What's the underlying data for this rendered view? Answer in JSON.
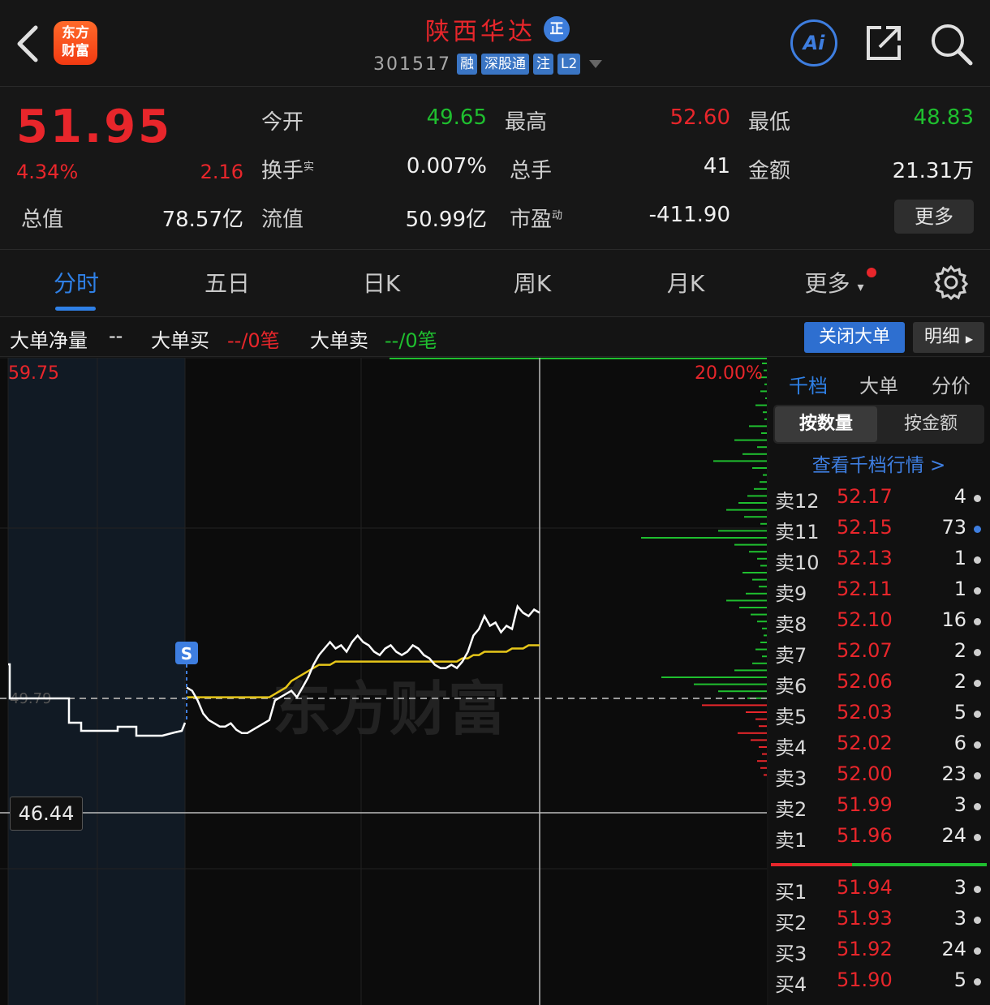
{
  "header": {
    "logo_line1": "东方",
    "logo_line2": "财富",
    "stock_name": "陕西华达",
    "zheng_badge": "正",
    "stock_code": "301517",
    "tags": [
      "融",
      "深股通",
      "注",
      "L2"
    ],
    "ai_label": "Ai"
  },
  "quote": {
    "price": "51.95",
    "change_pct": "4.34%",
    "change": "2.16",
    "open_label": "今开",
    "open": "49.65",
    "high_label": "最高",
    "high": "52.60",
    "low_label": "最低",
    "low": "48.83",
    "turnover_label": "换手",
    "turnover_sup": "实",
    "turnover": "0.007%",
    "volume_label": "总手",
    "volume": "41",
    "amount_label": "金额",
    "amount": "21.31万",
    "mktcap_label": "总值",
    "mktcap": "78.57亿",
    "float_label": "流值",
    "float": "50.99亿",
    "pe_label": "市盈",
    "pe_sup": "动",
    "pe": "-411.90",
    "more_label": "更多"
  },
  "tabs": [
    "分时",
    "五日",
    "日K",
    "周K",
    "月K",
    "更多"
  ],
  "big_order": {
    "net_label": "大单净量",
    "net_value": "--",
    "buy_label": "大单买",
    "buy_value": "--/0笔",
    "sell_label": "大单卖",
    "sell_value": "--/0笔",
    "close_btn": "关闭大单",
    "detail_btn": "明细"
  },
  "chart": {
    "high_label": "59.75",
    "pct_label": "20.00%",
    "cursor_price": "46.44",
    "prev_close_label": "49.79",
    "signal_label": "S",
    "watermark": "东方财富",
    "colors": {
      "price_line": "#ffffff",
      "avg_line": "#e6c619",
      "up": "#e8262b",
      "down": "#1fbf2f"
    }
  },
  "chart_data": {
    "type": "line",
    "series": [
      {
        "values": [
          49.6,
          49.5,
          49.2,
          48.8,
          48.6,
          48.5,
          48.4,
          48.4,
          48.5,
          48.3,
          48.2,
          48.2,
          48.3,
          48.4,
          48.5,
          48.6,
          49.2,
          49.3,
          49.4,
          49.5,
          49.3,
          49.6,
          49.9,
          50.3,
          50.6,
          50.8,
          51.0,
          50.8,
          50.9,
          50.7,
          51.0,
          51.2,
          51.0,
          50.9,
          50.7,
          50.6,
          50.8,
          50.9,
          50.7,
          50.6,
          50.7,
          50.9,
          50.8,
          50.6,
          50.5,
          50.3,
          50.2,
          50.2,
          50.3,
          50.2,
          50.4,
          50.7,
          51.2,
          51.4,
          51.8,
          51.5,
          51.6,
          51.3,
          51.5,
          51.4,
          52.1,
          51.9,
          51.8,
          52.0,
          51.9
        ]
      },
      {
        "values": [
          49.3,
          49.3,
          49.3,
          49.3,
          49.3,
          49.3,
          49.3,
          49.3,
          49.3,
          49.3,
          49.3,
          49.3,
          49.3,
          49.3,
          49.3,
          49.3,
          49.4,
          49.5,
          49.6,
          49.8,
          49.9,
          50.0,
          50.1,
          50.2,
          50.3,
          50.3,
          50.3,
          50.4,
          50.4,
          50.4,
          50.4,
          50.4,
          50.4,
          50.4,
          50.4,
          50.4,
          50.4,
          50.4,
          50.4,
          50.4,
          50.4,
          50.4,
          50.4,
          50.4,
          50.4,
          50.4,
          50.4,
          50.4,
          50.4,
          50.4,
          50.5,
          50.5,
          50.6,
          50.6,
          50.7,
          50.7,
          50.7,
          50.7,
          50.7,
          50.8,
          50.8,
          50.8,
          50.9,
          50.9,
          50.9
        ]
      }
    ],
    "ylim": [
      39.83,
      59.75
    ]
  },
  "orderbook": {
    "tabs": [
      "千档",
      "大单",
      "分价"
    ],
    "seg_active": "按数量",
    "seg_other": "按金额",
    "link": "查看千档行情 >",
    "asks": [
      {
        "label": "卖12",
        "price": "52.17",
        "qty": "4",
        "dot": "gray"
      },
      {
        "label": "卖11",
        "price": "52.15",
        "qty": "73",
        "dot": "blue"
      },
      {
        "label": "卖10",
        "price": "52.13",
        "qty": "1",
        "dot": "gray"
      },
      {
        "label": "卖9",
        "price": "52.11",
        "qty": "1",
        "dot": "gray"
      },
      {
        "label": "卖8",
        "price": "52.10",
        "qty": "16",
        "dot": "gray"
      },
      {
        "label": "卖7",
        "price": "52.07",
        "qty": "2",
        "dot": "gray"
      },
      {
        "label": "卖6",
        "price": "52.06",
        "qty": "2",
        "dot": "gray"
      },
      {
        "label": "卖5",
        "price": "52.03",
        "qty": "5",
        "dot": "gray"
      },
      {
        "label": "卖4",
        "price": "52.02",
        "qty": "6",
        "dot": "gray"
      },
      {
        "label": "卖3",
        "price": "52.00",
        "qty": "23",
        "dot": "gray"
      },
      {
        "label": "卖2",
        "price": "51.99",
        "qty": "3",
        "dot": "gray"
      },
      {
        "label": "卖1",
        "price": "51.96",
        "qty": "24",
        "dot": "gray"
      }
    ],
    "bids": [
      {
        "label": "买1",
        "price": "51.94",
        "qty": "3",
        "dot": "gray"
      },
      {
        "label": "买2",
        "price": "51.93",
        "qty": "3",
        "dot": "gray"
      },
      {
        "label": "买3",
        "price": "51.92",
        "qty": "24",
        "dot": "gray"
      },
      {
        "label": "买4",
        "price": "51.90",
        "qty": "5",
        "dot": "gray"
      }
    ]
  }
}
